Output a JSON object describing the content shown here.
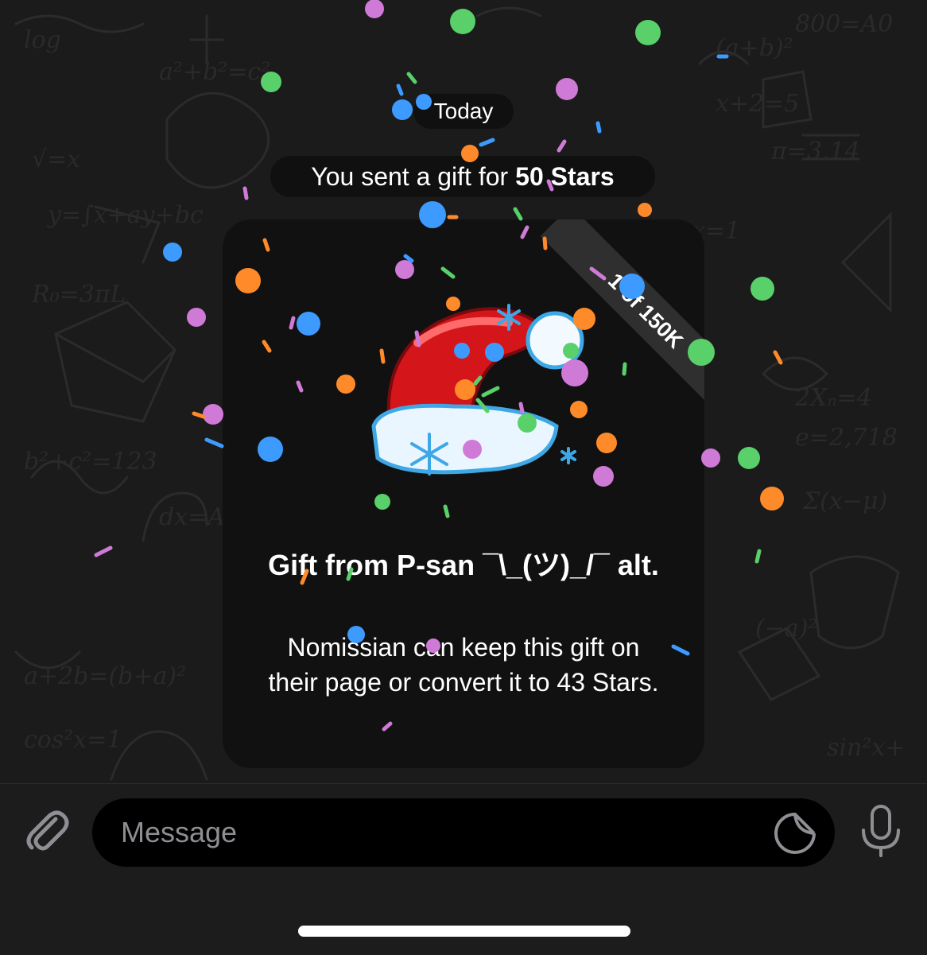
{
  "chat": {
    "date_label": "Today",
    "service_message": {
      "prefix": "You sent a gift for",
      "amount": "50 Stars"
    },
    "gift": {
      "ribbon": "1 of 150K",
      "title": "Gift from P-san ¯\\_(ツ)_/¯ alt.",
      "description": "Nomissian can keep this gift on their page or convert it to 43 Stars.",
      "icon": "santa-hat-icon"
    }
  },
  "input_bar": {
    "placeholder": "Message",
    "attach_icon": "paperclip-icon",
    "sticker_icon": "sticker-icon",
    "mic_icon": "microphone-icon"
  },
  "colors": {
    "chat_background": "#1b1b1b",
    "bubble": "#111111",
    "ribbon": "#2f2f2f",
    "confetti": [
      "#3d9bff",
      "#59d06a",
      "#ff8a2a",
      "#d07ad8"
    ]
  }
}
